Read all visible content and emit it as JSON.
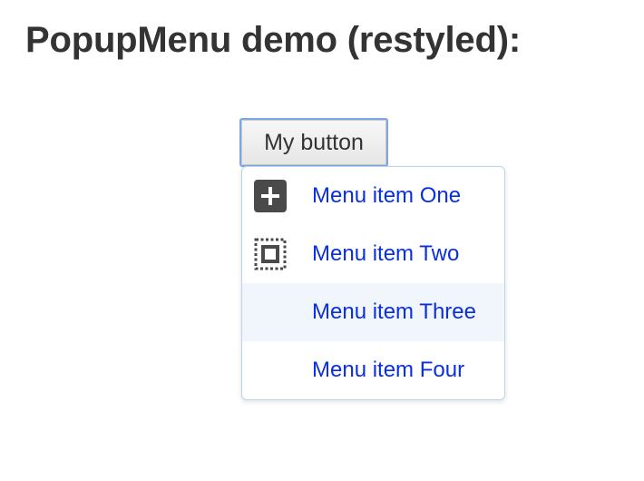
{
  "page": {
    "title": "PopupMenu demo (restyled):"
  },
  "button": {
    "label": "My button"
  },
  "menu": {
    "items": [
      {
        "label": "Menu item One",
        "icon": "add-icon"
      },
      {
        "label": "Menu item Two",
        "icon": "select-all-icon"
      },
      {
        "label": "Menu item Three",
        "icon": "",
        "highlighted": true
      },
      {
        "label": "Menu item Four",
        "icon": ""
      }
    ]
  },
  "colors": {
    "link_text": "#0a2fdc",
    "menu_border": "#b9d6ea",
    "highlight_bg": "#f1f6fd",
    "button_focus_border": "#7ea6e6",
    "title_text": "#333333"
  }
}
